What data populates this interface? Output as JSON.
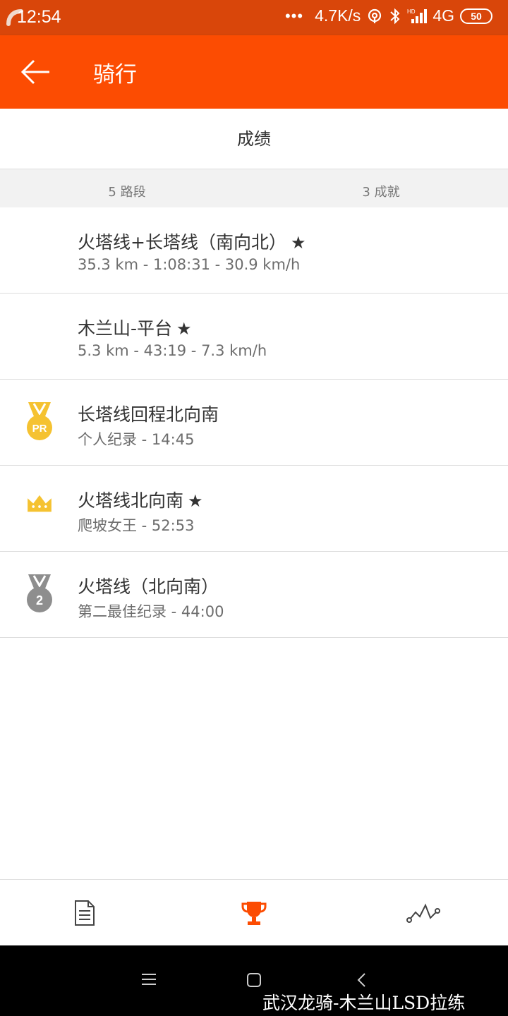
{
  "status_bar": {
    "time": "12:54",
    "dots": "•••",
    "speed": "4.7K/s",
    "network": "4G",
    "battery": "50"
  },
  "app_bar": {
    "title": "骑行"
  },
  "section": {
    "title": "成绩"
  },
  "summary": {
    "segments": "5 路段",
    "achievements": "3 成就"
  },
  "rows": [
    {
      "icon": "none",
      "title": "火塔线+长塔线（南向北）",
      "starred": true,
      "star": "★",
      "subtitle": "35.3 km - 1:08:31 - 30.9 km/h"
    },
    {
      "icon": "none",
      "title": "木兰山-平台",
      "starred": true,
      "star": "★",
      "subtitle": "5.3 km - 43:19 - 7.3 km/h"
    },
    {
      "icon": "pr-medal-icon",
      "title": "长塔线回程北向南",
      "starred": false,
      "star": "",
      "subtitle": "个人纪录 - 14:45"
    },
    {
      "icon": "crown-icon",
      "title": "火塔线北向南",
      "starred": true,
      "star": "★",
      "subtitle": "爬坡女王 - 52:53"
    },
    {
      "icon": "second-place-medal-icon",
      "title": "火塔线（北向南）",
      "starred": false,
      "star": "",
      "subtitle": "第二最佳纪录 - 44:00"
    }
  ],
  "icons": {
    "pr_badge_text": "PR",
    "second_badge_text": "2"
  },
  "bottom_nav": [
    {
      "icon": "document-icon",
      "active": false
    },
    {
      "icon": "trophy-icon",
      "active": true
    },
    {
      "icon": "analysis-chart-icon",
      "active": false
    }
  ],
  "colors": {
    "accent": "#fc4c02",
    "status_bar": "#d9460a",
    "gold": "#f5c231",
    "silver": "#8e8e8e"
  },
  "watermark": "武汉龙骑-木兰山LSD拉练"
}
